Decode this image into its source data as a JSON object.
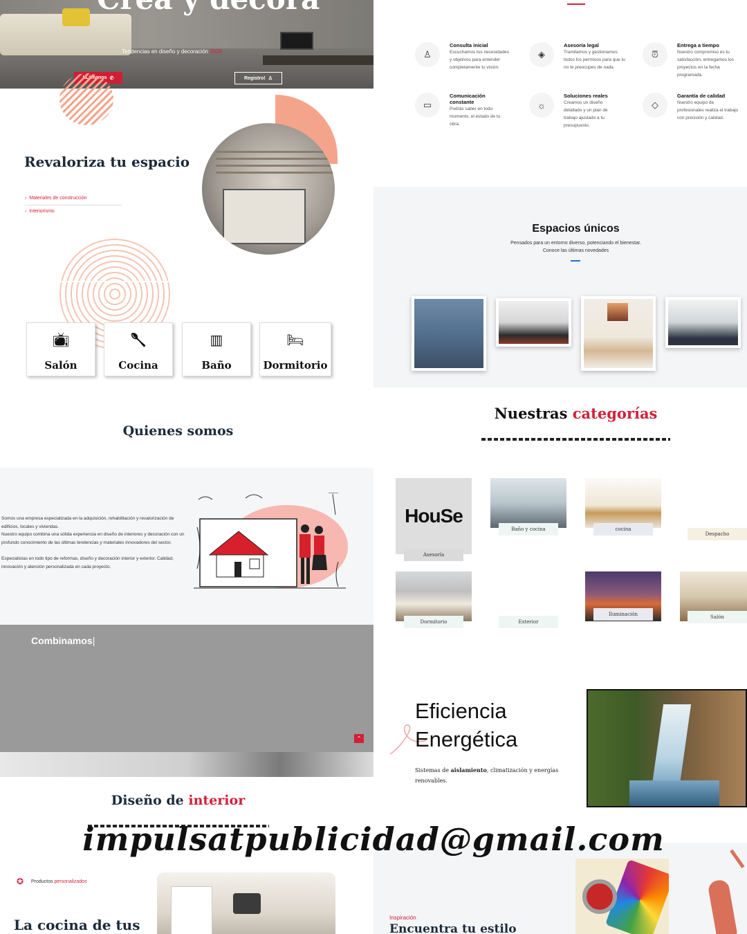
{
  "hero": {
    "title": "Crea y decora",
    "subtitle_prefix": "Tendencias en diseño y decoración",
    "subtitle_year": "2025",
    "call_button": "LLámanos",
    "register_button": "Registro!"
  },
  "revaloriza": {
    "title": "Revaloriza tu espacio",
    "links": [
      "Materiales de construcción",
      "Interiorismo"
    ]
  },
  "rooms": [
    {
      "label": "Salón",
      "icon": "tv-icon"
    },
    {
      "label": "Cocina",
      "icon": "spoon-icon"
    },
    {
      "label": "Baño",
      "icon": "toothbrush-icon"
    },
    {
      "label": "Dormitorio",
      "icon": "bed-icon"
    }
  ],
  "quienes": {
    "title": "Quienes somos",
    "paragraphs": [
      "Somos una empresa especializada en la adquisición, rehabilitación y revalorización de edificios, locales y viviendas.",
      "Nuestro equipo combina una sólida experiencia en diseño de interiores y decoración con un profundo conocimiento de las últimas tendencias y materiales innovadores del sector.",
      "Especialistas en todo tipo de reformas, diseño y decoración interior y exterior. Calidad, innovación y atención personalizada en cada proyecto."
    ]
  },
  "combinamos": "Combinamos",
  "diseno": {
    "prefix": "Diseño de",
    "highlight": "interior"
  },
  "email": "impulsatpublicidad@gmail.com",
  "productos": {
    "prefix": "Productos",
    "highlight": "personalizados",
    "title": "La cocina de tus"
  },
  "features": [
    {
      "title": "Consulta inicial",
      "desc": "Escuchamos tus necesidades y objetivos para entender completamente tu visión.",
      "icon": "user-icon"
    },
    {
      "title": "Asesoría legal",
      "desc": "Tramitamos y gestionamos todos los permisos para que tu no te preocupes de nada",
      "icon": "layers-icon"
    },
    {
      "title": "Entrega a tiempo",
      "desc": "Nuestro compromiso es tu satisfacción, entregamos los proyectos en la fecha programada.",
      "icon": "alarm-clock-icon"
    },
    {
      "title": "Comunicación constante",
      "desc": "Podrás saber en todo momento, el estado de tu obra.",
      "icon": "devices-icon"
    },
    {
      "title": "Soluciones reales",
      "desc": "Creamos un diseño detallado y un plan de trabajo ajustado a tu presupuesto.",
      "icon": "lightbulb-icon"
    },
    {
      "title": "Garantía de calidad",
      "desc": "Nuestro equipo de profesionales realiza el trabajo con precisión y calidad.",
      "icon": "diamond-icon"
    }
  ],
  "espacios": {
    "title": "Espacios únicos",
    "sub1": "Pensados para un entorno diverso, potenciando el bienestar.",
    "sub2": "Conoce las últimas novedades"
  },
  "categorias": {
    "prefix": "Nuestras",
    "highlight": "categorías",
    "house_logo": "HouSe",
    "items": [
      "Asesoría",
      "Baño y cocina",
      "cocina",
      "Despacho",
      "Dormitorio",
      "Exterior",
      "Iluminación",
      "Salón"
    ]
  },
  "eficiencia": {
    "line1": "Eficiencia",
    "line2": "Energética",
    "sub_a": "Sistemas de",
    "sub_bold": "aislamiento",
    "sub_b": ", climatización y energías renovables."
  },
  "inspiracion": {
    "label": "Inspiración",
    "title": "Encuentra tu estilo"
  },
  "colors": {
    "accent": "#d3203a",
    "peach": "#f4a48b",
    "navy": "#1c2a3a",
    "blue": "#2a6fd6"
  }
}
